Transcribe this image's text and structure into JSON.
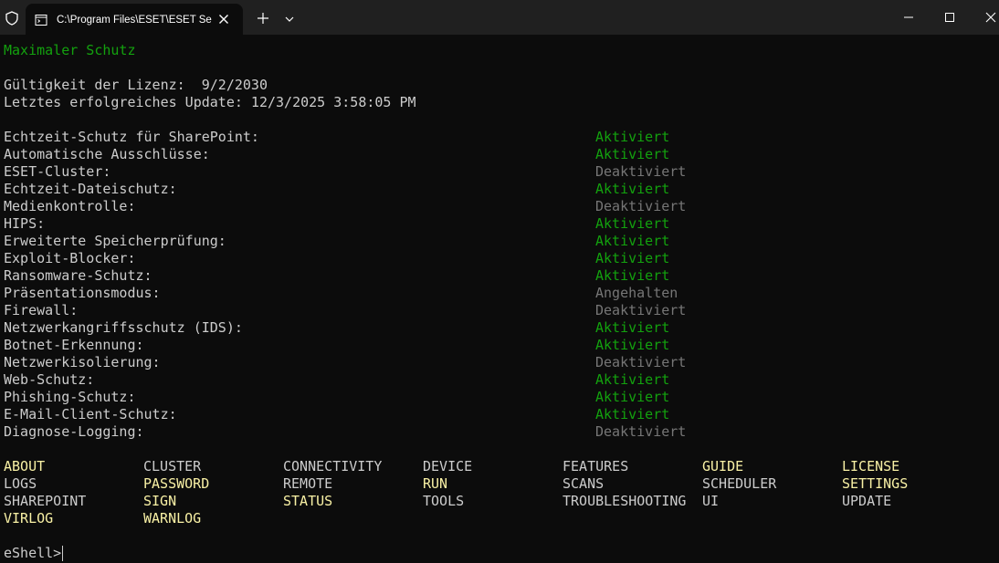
{
  "window": {
    "tab_title": "C:\\Program Files\\ESET\\ESET Se"
  },
  "terminal": {
    "heading": "Maximaler Schutz",
    "license_line": "Gültigkeit der Lizenz:  9/2/2030",
    "update_line": "Letztes erfolgreiches Update: 12/3/2025 3:58:05 PM",
    "features": [
      {
        "label": "Echtzeit-Schutz für SharePoint:",
        "status": "Aktiviert",
        "state": "active"
      },
      {
        "label": "Automatische Ausschlüsse:",
        "status": "Aktiviert",
        "state": "active"
      },
      {
        "label": "ESET-Cluster:",
        "status": "Deaktiviert",
        "state": "inactive"
      },
      {
        "label": "Echtzeit-Dateischutz:",
        "status": "Aktiviert",
        "state": "active"
      },
      {
        "label": "Medienkontrolle:",
        "status": "Deaktiviert",
        "state": "inactive"
      },
      {
        "label": "HIPS:",
        "status": "Aktiviert",
        "state": "active"
      },
      {
        "label": "Erweiterte Speicherprüfung:",
        "status": "Aktiviert",
        "state": "active"
      },
      {
        "label": "Exploit-Blocker:",
        "status": "Aktiviert",
        "state": "active"
      },
      {
        "label": "Ransomware-Schutz:",
        "status": "Aktiviert",
        "state": "active"
      },
      {
        "label": "Präsentationsmodus:",
        "status": "Angehalten",
        "state": "inactive"
      },
      {
        "label": "Firewall:",
        "status": "Deaktiviert",
        "state": "inactive"
      },
      {
        "label": "Netzwerkangriffsschutz (IDS):",
        "status": "Aktiviert",
        "state": "active"
      },
      {
        "label": "Botnet-Erkennung:",
        "status": "Aktiviert",
        "state": "active"
      },
      {
        "label": "Netzwerkisolierung:",
        "status": "Deaktiviert",
        "state": "inactive"
      },
      {
        "label": "Web-Schutz:",
        "status": "Aktiviert",
        "state": "active"
      },
      {
        "label": "Phishing-Schutz:",
        "status": "Aktiviert",
        "state": "active"
      },
      {
        "label": "E-Mail-Client-Schutz:",
        "status": "Aktiviert",
        "state": "active"
      },
      {
        "label": "Diagnose-Logging:",
        "status": "Deaktiviert",
        "state": "inactive"
      }
    ],
    "commands": [
      {
        "name": "ABOUT",
        "style": "highlight"
      },
      {
        "name": "CLUSTER",
        "style": "normal"
      },
      {
        "name": "CONNECTIVITY",
        "style": "normal"
      },
      {
        "name": "DEVICE",
        "style": "normal"
      },
      {
        "name": "FEATURES",
        "style": "normal"
      },
      {
        "name": "GUIDE",
        "style": "highlight"
      },
      {
        "name": "LICENSE",
        "style": "highlight"
      },
      {
        "name": "LOGS",
        "style": "normal"
      },
      {
        "name": "PASSWORD",
        "style": "highlight"
      },
      {
        "name": "REMOTE",
        "style": "normal"
      },
      {
        "name": "RUN",
        "style": "highlight"
      },
      {
        "name": "SCANS",
        "style": "normal"
      },
      {
        "name": "SCHEDULER",
        "style": "normal"
      },
      {
        "name": "SETTINGS",
        "style": "highlight"
      },
      {
        "name": "SHAREPOINT",
        "style": "normal"
      },
      {
        "name": "SIGN",
        "style": "highlight"
      },
      {
        "name": "STATUS",
        "style": "highlight"
      },
      {
        "name": "TOOLS",
        "style": "normal"
      },
      {
        "name": "TROUBLESHOOTING",
        "style": "normal"
      },
      {
        "name": "UI",
        "style": "normal"
      },
      {
        "name": "UPDATE",
        "style": "normal"
      },
      {
        "name": "VIRLOG",
        "style": "highlight"
      },
      {
        "name": "WARNLOG",
        "style": "highlight"
      }
    ],
    "prompt": "eShell>"
  },
  "colors": {
    "background": "#0c0c0c",
    "titlebar": "#202020",
    "text": "#cccccc",
    "active": "#13a10e",
    "inactive": "#767676",
    "highlight": "#f9f1a5"
  },
  "icons": [
    "shield-icon",
    "terminal-icon",
    "close-icon",
    "plus-icon",
    "chevron-down-icon",
    "minimize-icon",
    "maximize-icon",
    "window-close-icon"
  ]
}
